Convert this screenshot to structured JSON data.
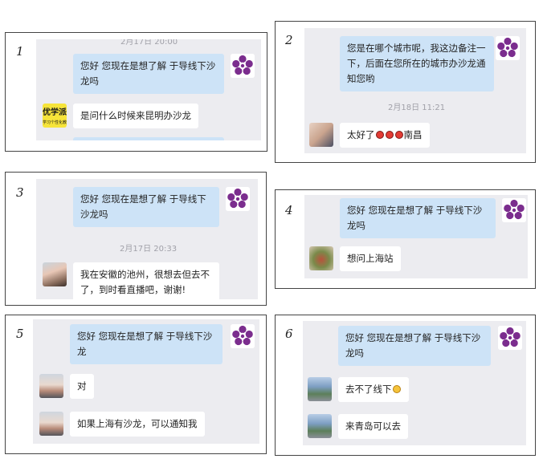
{
  "brand_color": "#7b2d8e",
  "panels": [
    {
      "number": "1",
      "timestamp_top": "2月17日 20:00",
      "messages": [
        {
          "from": "me",
          "text": "您好 您现在是想了解 于导线下沙龙吗"
        },
        {
          "from": "them",
          "avatar": "优学派",
          "avatar_sub": "学习个性化教育",
          "text": "是问什么时候来昆明办沙龙"
        }
      ]
    },
    {
      "number": "2",
      "timestamp": "2月18日  11:21",
      "messages": [
        {
          "from": "me",
          "text": "您是在哪个城市呢，我这边备注一下，后面在您所在的城市办沙龙通知您哟"
        },
        {
          "from": "them",
          "text_before": "太好了",
          "text_after": "南昌"
        }
      ]
    },
    {
      "number": "3",
      "timestamp": "2月17日  20:33",
      "messages": [
        {
          "from": "me",
          "text": "您好 您现在是想了解 于导线下沙龙吗"
        },
        {
          "from": "them",
          "text": "我在安徽的池州，很想去但去不了，到时看直播吧，谢谢!"
        }
      ]
    },
    {
      "number": "4",
      "messages": [
        {
          "from": "me",
          "text": "您好 您现在是想了解 于导线下沙龙吗"
        },
        {
          "from": "them",
          "text": "想问上海站"
        }
      ]
    },
    {
      "number": "5",
      "messages": [
        {
          "from": "me",
          "text": "您好 您现在是想了解 于导线下沙龙"
        },
        {
          "from": "them",
          "text": "对"
        },
        {
          "from": "them",
          "text": "如果上海有沙龙，可以通知我"
        }
      ]
    },
    {
      "number": "6",
      "messages": [
        {
          "from": "me",
          "text": "您好 您现在是想了解 于导线下沙龙吗"
        },
        {
          "from": "them",
          "text_before": "去不了线下"
        },
        {
          "from": "them",
          "text": "来青岛可以去"
        }
      ]
    }
  ]
}
